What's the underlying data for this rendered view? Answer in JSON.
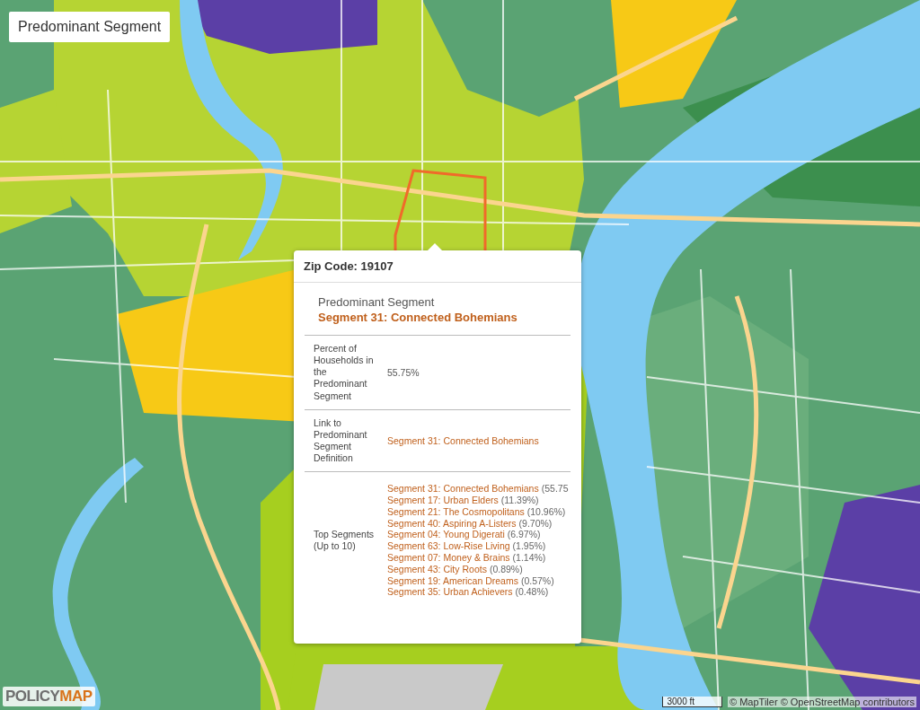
{
  "map_title": "Predominant Segment",
  "popup": {
    "title": "Zip Code: 19107",
    "heading": "Predominant Segment",
    "segment": "Segment 31: Connected Bohemians",
    "rows": [
      {
        "kind": "text",
        "label": "Percent of Households in the Predominant Segment",
        "value": "55.75%"
      },
      {
        "kind": "link",
        "label": "Link to Predominant Segment Definition",
        "value": "Segment 31: Connected Bohemians"
      },
      {
        "kind": "list",
        "label": "Top Segments (Up to 10)",
        "items": [
          {
            "name": "Segment 31: Connected Bohemians",
            "share": "(55.75"
          },
          {
            "name": "Segment 17: Urban Elders",
            "share": "(11.39%)"
          },
          {
            "name": "Segment 21: The Cosmopolitans",
            "share": "(10.96%)"
          },
          {
            "name": "Segment 40: Aspiring A-Listers",
            "share": "(9.70%)"
          },
          {
            "name": "Segment 04: Young Digerati",
            "share": "(6.97%)"
          },
          {
            "name": "Segment 63: Low-Rise Living",
            "share": "(1.95%)"
          },
          {
            "name": "Segment 07: Money & Brains",
            "share": "(1.14%)"
          },
          {
            "name": "Segment 43: City Roots",
            "share": "(0.89%)"
          },
          {
            "name": "Segment 19: American Dreams",
            "share": "(0.57%)"
          },
          {
            "name": "Segment 35: Urban Achievers",
            "share": "(0.48%)"
          }
        ]
      }
    ]
  },
  "logo": {
    "first": "POLICY",
    "second": "MAP"
  },
  "scale": "3000 ft",
  "attribution": "© MapTiler © OpenStreetMap contributors"
}
